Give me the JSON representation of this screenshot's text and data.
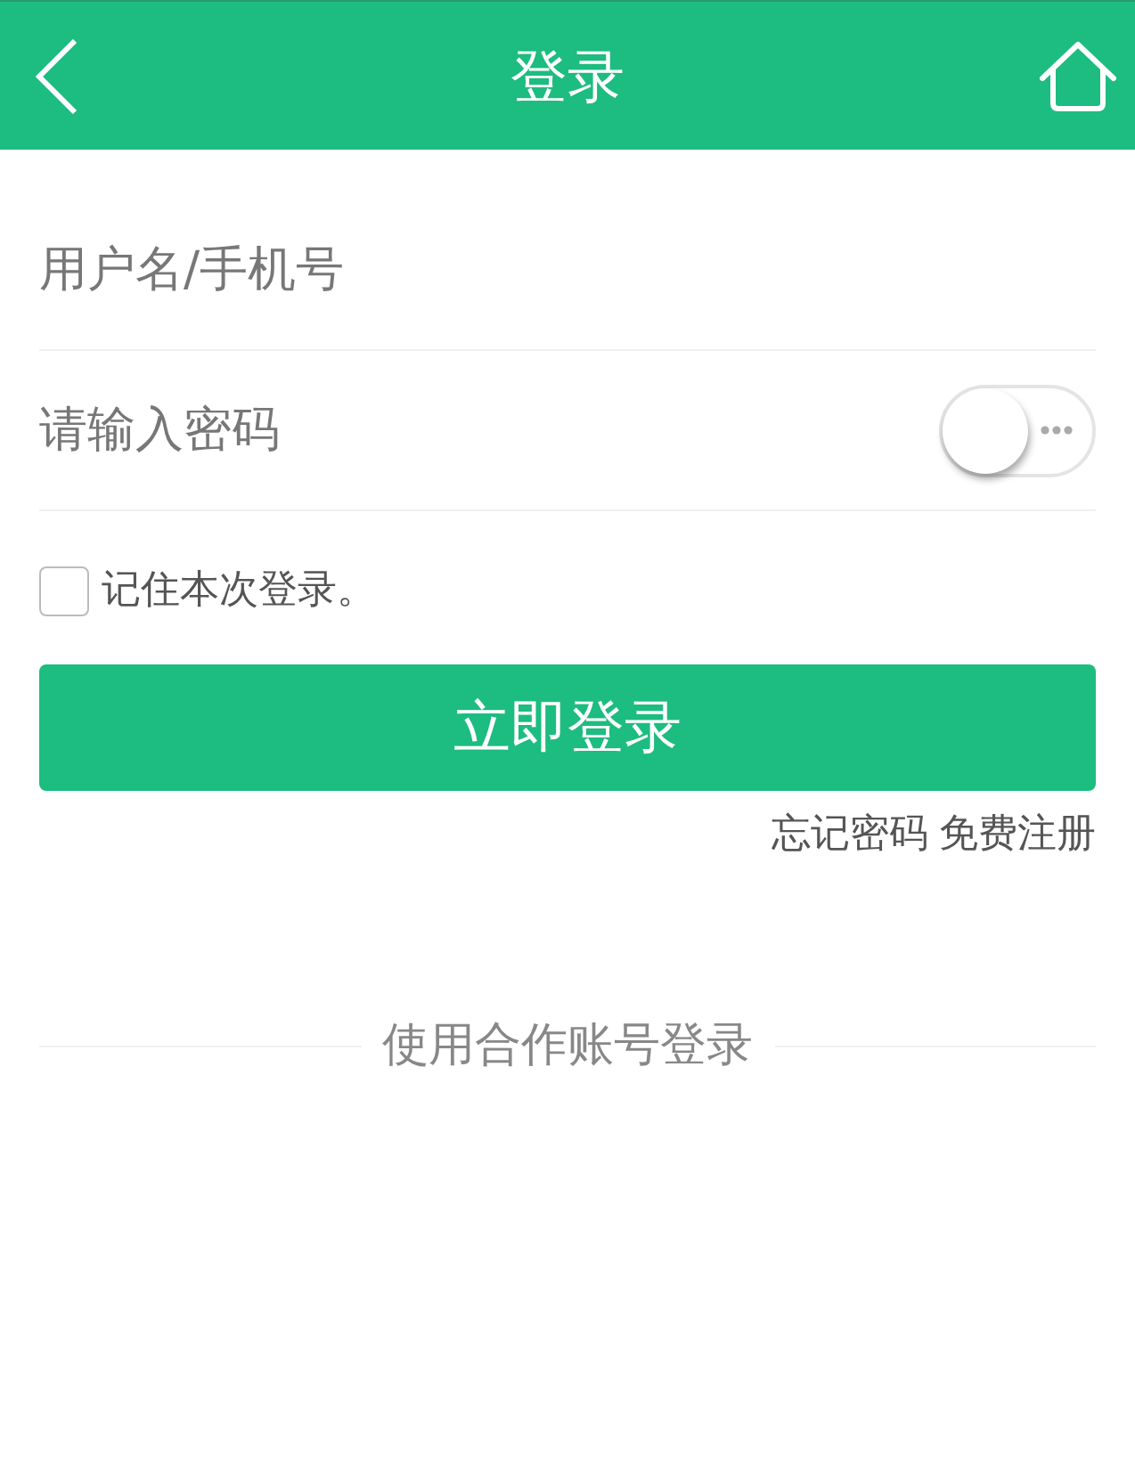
{
  "header": {
    "title": "登录"
  },
  "username": {
    "placeholder": "用户名/手机号"
  },
  "password": {
    "placeholder": "请输入密码",
    "visibility_toggle": {
      "on": false
    }
  },
  "remember": {
    "label": "记住本次登录。",
    "checked": false
  },
  "login_button": {
    "label": "立即登录"
  },
  "links": [
    "忘记密码",
    "免费注册"
  ],
  "partner_login": {
    "label": "使用合作账号登录"
  }
}
